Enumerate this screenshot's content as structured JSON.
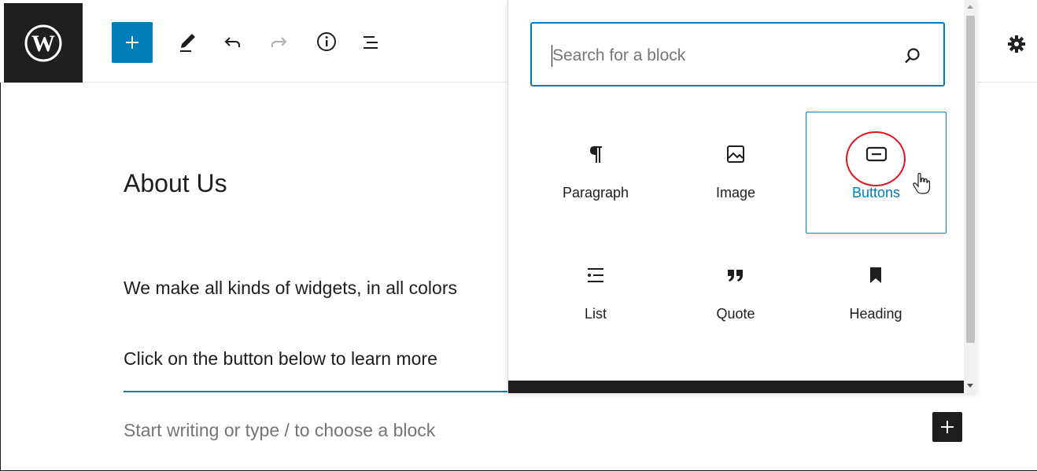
{
  "toolbar": {
    "logo_icon": "wordpress-logo-icon",
    "add_block_icon": "plus-icon",
    "tools_icon": "pencil-icon",
    "undo_icon": "undo-icon",
    "redo_icon": "redo-icon",
    "details_icon": "info-icon",
    "outline_icon": "list-view-icon",
    "settings_icon": "gear-icon"
  },
  "editor": {
    "title": "About Us",
    "paragraph_1": "We make all kinds of widgets, in all colors",
    "paragraph_2": "Click on the button below to learn more",
    "placeholder": "Start writing or type / to choose a block",
    "inline_add_icon": "plus-icon"
  },
  "inserter": {
    "search": {
      "placeholder": "Search for a block",
      "value": ""
    },
    "blocks": [
      {
        "label": "Paragraph",
        "icon": "paragraph-icon"
      },
      {
        "label": "Image",
        "icon": "image-icon"
      },
      {
        "label": "Buttons",
        "icon": "buttons-icon",
        "selected": true
      },
      {
        "label": "List",
        "icon": "list-icon"
      },
      {
        "label": "Quote",
        "icon": "quote-icon"
      },
      {
        "label": "Heading",
        "icon": "bookmark-icon"
      }
    ]
  },
  "colors": {
    "accent": "#007cba",
    "dark": "#1e1e1e",
    "highlight": "#e0141e"
  }
}
